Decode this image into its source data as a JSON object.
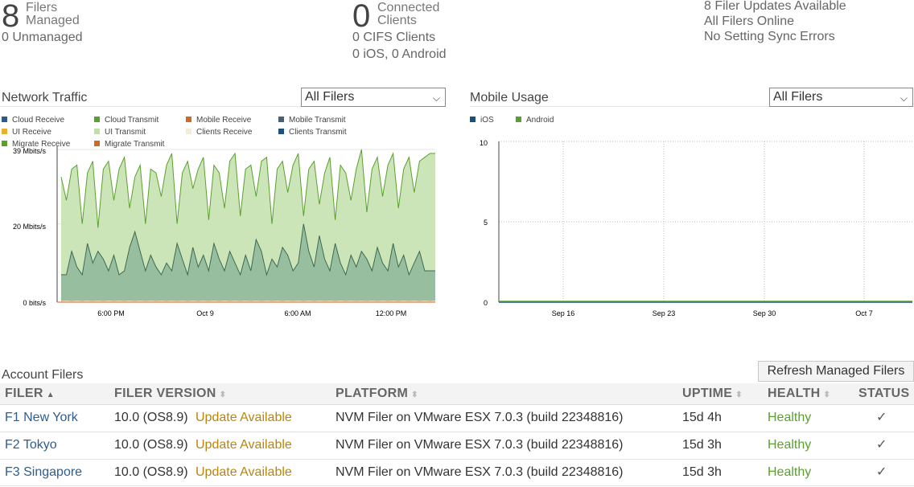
{
  "summary": {
    "filers": {
      "count": "8",
      "label1": "Filers",
      "label2": "Managed",
      "unmanaged": "0 Unmanaged"
    },
    "clients": {
      "count": "0",
      "label1": "Connected",
      "label2": "Clients",
      "cifs": "0 CIFS Clients",
      "mobile": "0 iOS, 0 Android"
    },
    "status": {
      "updates": "8 Filer Updates Available",
      "online": "All Filers Online",
      "sync": "No Setting Sync Errors"
    }
  },
  "network_traffic": {
    "title": "Network Traffic",
    "filter": "All Filers",
    "legend": [
      {
        "label": "Cloud Receive",
        "color": "#2c5a8a"
      },
      {
        "label": "Cloud Transmit",
        "color": "#5aa02c"
      },
      {
        "label": "Mobile Receive",
        "color": "#d2691e"
      },
      {
        "label": "Mobile Transmit",
        "color": "#4a6070"
      },
      {
        "label": "UI Receive",
        "color": "#e8b030"
      },
      {
        "label": "UI Transmit",
        "color": "#bfe0a8"
      },
      {
        "label": "Clients Receive",
        "color": "#f5ecd8"
      },
      {
        "label": "Clients Transmit",
        "color": "#1f4e79"
      },
      {
        "label": "Migrate Receive",
        "color": "#5aa02c"
      },
      {
        "label": "Migrate Transmit",
        "color": "#d2691e"
      }
    ]
  },
  "mobile_usage": {
    "title": "Mobile Usage",
    "filter": "All Filers",
    "legend": [
      {
        "label": "iOS",
        "color": "#1f4e79"
      },
      {
        "label": "Android",
        "color": "#5aa02c"
      }
    ]
  },
  "chart_data": [
    {
      "type": "area",
      "title": "Network Traffic",
      "y_ticks": [
        "39 Mbits/s",
        "20 Mbits/s",
        "0 bits/s"
      ],
      "x_ticks": [
        "6:00 PM",
        "Oct 9",
        "6:00 AM",
        "12:00 PM"
      ],
      "ylim": [
        0,
        39
      ],
      "y_unit": "Mbits/s",
      "series": [
        {
          "name": "UI Transmit",
          "color": "#5aa02c",
          "fill": "#cce5b8",
          "values": [
            32,
            26,
            34,
            35,
            20,
            33,
            36,
            19,
            34,
            36,
            26,
            34,
            37,
            24,
            32,
            35,
            20,
            34,
            33,
            27,
            35,
            38,
            20,
            33,
            36,
            29,
            34,
            37,
            21,
            35,
            33,
            24,
            36,
            38,
            22,
            34,
            35,
            27,
            36,
            37,
            20,
            34,
            36,
            28,
            35,
            38,
            22,
            34,
            36,
            25,
            33,
            37,
            21,
            35,
            33,
            26,
            34,
            39,
            23,
            34,
            37,
            27,
            35,
            38,
            24,
            34,
            37,
            28,
            36,
            37,
            38,
            38
          ]
        },
        {
          "name": "Mobile Transmit",
          "color": "#3e6a52",
          "fill": "#98bea0",
          "values": [
            7,
            7,
            13,
            9,
            7,
            15,
            10,
            13,
            11,
            8,
            12,
            7,
            8,
            14,
            18,
            13,
            8,
            12,
            9,
            7,
            10,
            8,
            15,
            11,
            7,
            14,
            9,
            12,
            8,
            15,
            11,
            8,
            13,
            10,
            7,
            12,
            8,
            16,
            13,
            7,
            11,
            9,
            14,
            12,
            8,
            10,
            20,
            13,
            9,
            17,
            11,
            8,
            15,
            10,
            7,
            12,
            9,
            13,
            11,
            8,
            14,
            10,
            8,
            15,
            9,
            12,
            7,
            10,
            13,
            8,
            8,
            8
          ]
        },
        {
          "name": "Cloud Receive",
          "color": "#e0a060",
          "fill": "#f5ecd8",
          "values": [
            0.4,
            0.5,
            0.4,
            0.5,
            0.4,
            0.5,
            0.4,
            0.5,
            0.4,
            0.5,
            0.4,
            0.5,
            0.4,
            0.5,
            0.4,
            0.5,
            0.4,
            0.5,
            0.4,
            0.5,
            0.4,
            0.5,
            0.4,
            0.5,
            0.4,
            0.5,
            0.4,
            0.5,
            0.4,
            0.5,
            0.4,
            0.5,
            0.4,
            0.5,
            0.4,
            0.5,
            0.4,
            0.5,
            0.4,
            0.5,
            0.4,
            0.5,
            0.4,
            0.5,
            0.4,
            0.5,
            0.4,
            0.5,
            0.4,
            0.5,
            0.4,
            0.5,
            0.4,
            0.5,
            0.4,
            0.5,
            0.4,
            0.5,
            0.4,
            0.5,
            0.4,
            0.5,
            0.4,
            0.5,
            0.4,
            0.5,
            0.4,
            0.5,
            0.4,
            0.5,
            0.4,
            0.5
          ]
        }
      ]
    },
    {
      "type": "line",
      "title": "Mobile Usage",
      "y_ticks": [
        "10",
        "5",
        "0"
      ],
      "x_ticks": [
        "Sep 16",
        "Sep 23",
        "Sep 30",
        "Oct 7"
      ],
      "ylim": [
        0,
        10
      ],
      "series": [
        {
          "name": "iOS",
          "color": "#1f4e79",
          "values": [
            0,
            0,
            0,
            0
          ]
        },
        {
          "name": "Android",
          "color": "#5aa02c",
          "values": [
            0,
            0,
            0,
            0
          ]
        }
      ]
    }
  ],
  "account_filers": {
    "title": "Account Filers",
    "refresh_label": "Refresh Managed Filers",
    "columns": [
      "FILER",
      "FILER VERSION",
      "PLATFORM",
      "UPTIME",
      "HEALTH",
      "STATUS"
    ],
    "sort_up": "▲",
    "sort_both": "⬍",
    "rows": [
      {
        "filer": "F1 New York",
        "version": "10.0 (OS8.9)",
        "update": "Update Available",
        "platform": "NVM Filer on VMware ESX 7.0.3 (build 22348816)",
        "uptime": "15d 4h",
        "health": "Healthy",
        "status": "✓"
      },
      {
        "filer": "F2 Tokyo",
        "version": "10.0 (OS8.9)",
        "update": "Update Available",
        "platform": "NVM Filer on VMware ESX 7.0.3 (build 22348816)",
        "uptime": "15d 3h",
        "health": "Healthy",
        "status": "✓"
      },
      {
        "filer": "F3 Singapore",
        "version": "10.0 (OS8.9)",
        "update": "Update Available",
        "platform": "NVM Filer on VMware ESX 7.0.3 (build 22348816)",
        "uptime": "15d 3h",
        "health": "Healthy",
        "status": "✓"
      }
    ]
  }
}
